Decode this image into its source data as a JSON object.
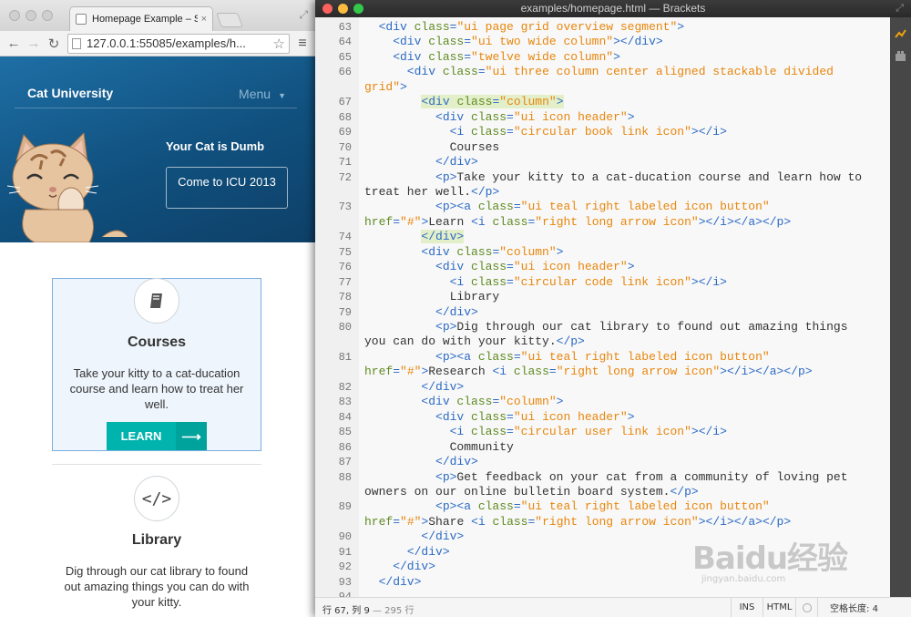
{
  "chrome": {
    "tab_title": "Homepage Example – Sem",
    "tab_close": "×",
    "url": "127.0.0.1:55085/examples/h...",
    "back_icon": "arrow-left-icon",
    "forward_icon": "arrow-right-icon",
    "reload_icon": "reload-icon",
    "bookmark_icon": "star-icon",
    "menu_icon": "hamburger-icon"
  },
  "site": {
    "brand": "Cat University",
    "menu_label": "Menu",
    "tagline": "Your Cat is Dumb",
    "cta_label": "Come to ICU 2013",
    "cards": [
      {
        "title": "Courses",
        "icon": "book-icon",
        "text": "Take your kitty to a cat-ducation course and learn how to treat her well.",
        "button": "LEARN"
      },
      {
        "title": "Library",
        "icon": "code-icon",
        "text": "Dig through our cat library to found out amazing things you can do with your kitty."
      }
    ]
  },
  "brackets": {
    "window_title": "examples/homepage.html — Brackets",
    "status": {
      "position": "行 67, 列 9",
      "line_count": "— 295 行",
      "mode": "INS",
      "language": "HTML",
      "indent": "空格长度: 4"
    },
    "lines": [
      {
        "n": "63",
        "code": [
          [
            "t",
            "  <div "
          ],
          [
            "a",
            "class"
          ],
          [
            "t",
            "="
          ],
          [
            "s",
            "\"ui page grid overview segment\""
          ],
          [
            "t",
            ">"
          ]
        ]
      },
      {
        "n": "64",
        "code": [
          [
            "t",
            "    <div "
          ],
          [
            "a",
            "class"
          ],
          [
            "t",
            "="
          ],
          [
            "s",
            "\"ui two wide column\""
          ],
          [
            "t",
            "></div>"
          ]
        ]
      },
      {
        "n": "65",
        "code": [
          [
            "t",
            "    <div "
          ],
          [
            "a",
            "class"
          ],
          [
            "t",
            "="
          ],
          [
            "s",
            "\"twelve wide column\""
          ],
          [
            "t",
            ">"
          ]
        ]
      },
      {
        "n": "66",
        "code": [
          [
            "t",
            "      <div "
          ],
          [
            "a",
            "class"
          ],
          [
            "t",
            "="
          ],
          [
            "s",
            "\"ui three column center aligned stackable divided"
          ]
        ]
      },
      {
        "n": "",
        "code": [
          [
            "s",
            "grid\""
          ],
          [
            "t",
            ">"
          ]
        ]
      },
      {
        "n": "67",
        "code": [
          [
            "t",
            "        <div "
          ],
          [
            "a",
            "class"
          ],
          [
            "t",
            "="
          ],
          [
            "s",
            "\"column\""
          ],
          [
            "t",
            ">"
          ]
        ],
        "hl": true
      },
      {
        "n": "68",
        "code": [
          [
            "t",
            "          <div "
          ],
          [
            "a",
            "class"
          ],
          [
            "t",
            "="
          ],
          [
            "s",
            "\"ui icon header\""
          ],
          [
            "t",
            ">"
          ]
        ]
      },
      {
        "n": "69",
        "code": [
          [
            "t",
            "            <i "
          ],
          [
            "a",
            "class"
          ],
          [
            "t",
            "="
          ],
          [
            "s",
            "\"circular book link icon\""
          ],
          [
            "t",
            "></i>"
          ]
        ]
      },
      {
        "n": "70",
        "code": [
          [
            "x",
            "            Courses"
          ]
        ]
      },
      {
        "n": "71",
        "code": [
          [
            "t",
            "          </div>"
          ]
        ]
      },
      {
        "n": "72",
        "code": [
          [
            "t",
            "          <p>"
          ],
          [
            "x",
            "Take your kitty to a cat-ducation course and learn how to"
          ]
        ]
      },
      {
        "n": "",
        "code": [
          [
            "x",
            "treat her well."
          ],
          [
            "t",
            "</p>"
          ]
        ]
      },
      {
        "n": "73",
        "code": [
          [
            "t",
            "          <p><a "
          ],
          [
            "a",
            "class"
          ],
          [
            "t",
            "="
          ],
          [
            "s",
            "\"ui teal right labeled icon button\""
          ]
        ]
      },
      {
        "n": "",
        "code": [
          [
            "a",
            "href"
          ],
          [
            "t",
            "="
          ],
          [
            "s",
            "\"#\""
          ],
          [
            "t",
            ">"
          ],
          [
            "x",
            "Learn "
          ],
          [
            "t",
            "<i "
          ],
          [
            "a",
            "class"
          ],
          [
            "t",
            "="
          ],
          [
            "s",
            "\"right long arrow icon\""
          ],
          [
            "t",
            "></i></a></p>"
          ]
        ]
      },
      {
        "n": "74",
        "code": [
          [
            "t",
            "        </div>"
          ]
        ],
        "hl": true
      },
      {
        "n": "75",
        "code": [
          [
            "t",
            "        <div "
          ],
          [
            "a",
            "class"
          ],
          [
            "t",
            "="
          ],
          [
            "s",
            "\"column\""
          ],
          [
            "t",
            ">"
          ]
        ]
      },
      {
        "n": "76",
        "code": [
          [
            "t",
            "          <div "
          ],
          [
            "a",
            "class"
          ],
          [
            "t",
            "="
          ],
          [
            "s",
            "\"ui icon header\""
          ],
          [
            "t",
            ">"
          ]
        ]
      },
      {
        "n": "77",
        "code": [
          [
            "t",
            "            <i "
          ],
          [
            "a",
            "class"
          ],
          [
            "t",
            "="
          ],
          [
            "s",
            "\"circular code link icon\""
          ],
          [
            "t",
            "></i>"
          ]
        ]
      },
      {
        "n": "78",
        "code": [
          [
            "x",
            "            Library"
          ]
        ]
      },
      {
        "n": "79",
        "code": [
          [
            "t",
            "          </div>"
          ]
        ]
      },
      {
        "n": "80",
        "code": [
          [
            "t",
            "          <p>"
          ],
          [
            "x",
            "Dig through our cat library to found out amazing things"
          ]
        ]
      },
      {
        "n": "",
        "code": [
          [
            "x",
            "you can do with your kitty."
          ],
          [
            "t",
            "</p>"
          ]
        ]
      },
      {
        "n": "81",
        "code": [
          [
            "t",
            "          <p><a "
          ],
          [
            "a",
            "class"
          ],
          [
            "t",
            "="
          ],
          [
            "s",
            "\"ui teal right labeled icon button\""
          ]
        ]
      },
      {
        "n": "",
        "code": [
          [
            "a",
            "href"
          ],
          [
            "t",
            "="
          ],
          [
            "s",
            "\"#\""
          ],
          [
            "t",
            ">"
          ],
          [
            "x",
            "Research "
          ],
          [
            "t",
            "<i "
          ],
          [
            "a",
            "class"
          ],
          [
            "t",
            "="
          ],
          [
            "s",
            "\"right long arrow icon\""
          ],
          [
            "t",
            "></i></a></p>"
          ]
        ]
      },
      {
        "n": "82",
        "code": [
          [
            "t",
            "        </div>"
          ]
        ]
      },
      {
        "n": "83",
        "code": [
          [
            "t",
            "        <div "
          ],
          [
            "a",
            "class"
          ],
          [
            "t",
            "="
          ],
          [
            "s",
            "\"column\""
          ],
          [
            "t",
            ">"
          ]
        ]
      },
      {
        "n": "84",
        "code": [
          [
            "t",
            "          <div "
          ],
          [
            "a",
            "class"
          ],
          [
            "t",
            "="
          ],
          [
            "s",
            "\"ui icon header\""
          ],
          [
            "t",
            ">"
          ]
        ]
      },
      {
        "n": "85",
        "code": [
          [
            "t",
            "            <i "
          ],
          [
            "a",
            "class"
          ],
          [
            "t",
            "="
          ],
          [
            "s",
            "\"circular user link icon\""
          ],
          [
            "t",
            "></i>"
          ]
        ]
      },
      {
        "n": "86",
        "code": [
          [
            "x",
            "            Community"
          ]
        ]
      },
      {
        "n": "87",
        "code": [
          [
            "t",
            "          </div>"
          ]
        ]
      },
      {
        "n": "88",
        "code": [
          [
            "t",
            "          <p>"
          ],
          [
            "x",
            "Get feedback on your cat from a community of loving pet"
          ]
        ]
      },
      {
        "n": "",
        "code": [
          [
            "x",
            "owners on our online bulletin board system."
          ],
          [
            "t",
            "</p>"
          ]
        ]
      },
      {
        "n": "89",
        "code": [
          [
            "t",
            "          <p><a "
          ],
          [
            "a",
            "class"
          ],
          [
            "t",
            "="
          ],
          [
            "s",
            "\"ui teal right labeled icon button\""
          ]
        ]
      },
      {
        "n": "",
        "code": [
          [
            "a",
            "href"
          ],
          [
            "t",
            "="
          ],
          [
            "s",
            "\"#\""
          ],
          [
            "t",
            ">"
          ],
          [
            "x",
            "Share "
          ],
          [
            "t",
            "<i "
          ],
          [
            "a",
            "class"
          ],
          [
            "t",
            "="
          ],
          [
            "s",
            "\"right long arrow icon\""
          ],
          [
            "t",
            "></i></a></p>"
          ]
        ]
      },
      {
        "n": "90",
        "code": [
          [
            "t",
            "        </div>"
          ]
        ]
      },
      {
        "n": "91",
        "code": [
          [
            "t",
            "      </div>"
          ]
        ]
      },
      {
        "n": "92",
        "code": [
          [
            "t",
            "    </div>"
          ]
        ]
      },
      {
        "n": "93",
        "code": [
          [
            "t",
            "  </div>"
          ]
        ]
      },
      {
        "n": "94",
        "code": []
      }
    ]
  },
  "watermark": {
    "big": "Baidu经验",
    "small": "jingyan.baidu.com"
  },
  "colors": {
    "teal_button": "#00b3ad",
    "tag": "#2b6ac4",
    "attribute": "#5f8a21",
    "string": "#e8860c",
    "highlight": "#e3efc9"
  }
}
